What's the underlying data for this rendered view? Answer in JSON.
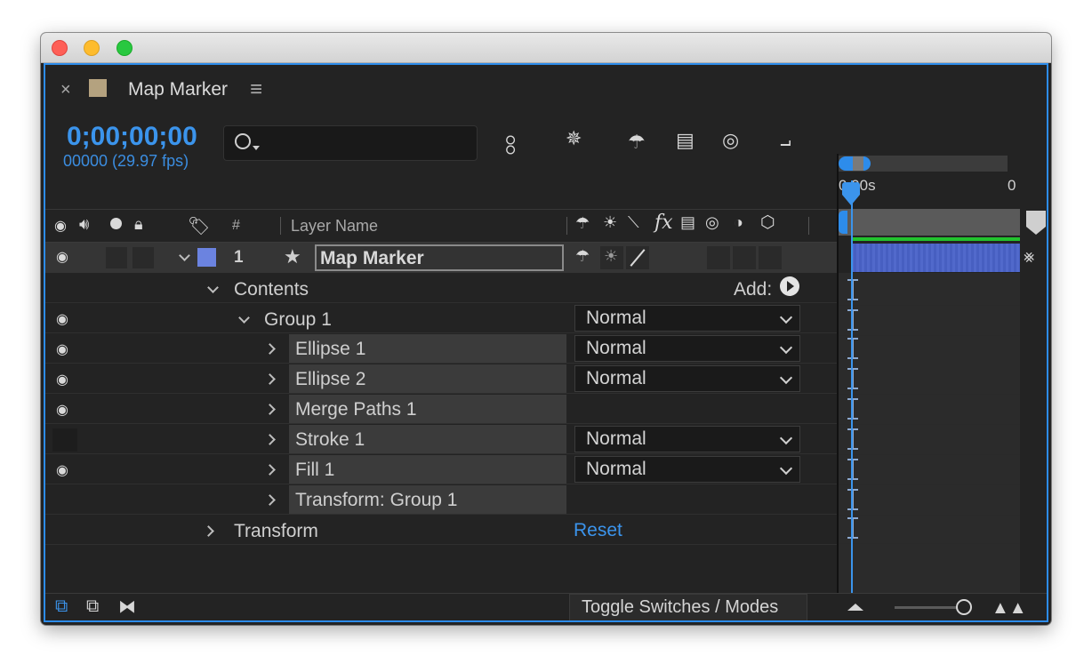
{
  "window": {
    "traffic_lights": {
      "close": "#fe5f57",
      "minimize": "#febc2e",
      "zoom": "#28c840"
    }
  },
  "panel": {
    "close_glyph": "×",
    "swatch_color": "#b4a27f",
    "title": "Map Marker",
    "menu_glyph": "≡",
    "accent": "#2d8ceb"
  },
  "time": {
    "timecode": "0;00;00;00",
    "frames": "00000 (29.97 fps)"
  },
  "search": {
    "placeholder": "",
    "value": ""
  },
  "toolbar": {
    "icons": [
      "composition-flowchart-icon",
      "draft-3d-icon",
      "shy-layers-icon",
      "frame-blending-icon",
      "motion-blur-icon",
      "graph-editor-icon"
    ]
  },
  "columns": {
    "number": "#",
    "layer_name": "Layer Name",
    "switches_fx": "fx"
  },
  "layer": {
    "index": "1",
    "name": "Map Marker",
    "label_color": "#6b83e0"
  },
  "tree": {
    "contents_label": "Contents",
    "add_label": "Add:",
    "group_label": "Group 1",
    "items": [
      {
        "name": "Ellipse 1",
        "mode": "Normal",
        "visible": true
      },
      {
        "name": "Ellipse 2",
        "mode": "Normal",
        "visible": true
      },
      {
        "name": "Merge Paths 1",
        "mode": "",
        "visible": true
      },
      {
        "name": "Stroke 1",
        "mode": "Normal",
        "visible": false
      },
      {
        "name": "Fill 1",
        "mode": "Normal",
        "visible": true
      },
      {
        "name": "Transform: Group 1",
        "mode": "",
        "visible": false
      }
    ],
    "group_mode": "Normal",
    "transform_label": "Transform",
    "reset_label": "Reset"
  },
  "timeline": {
    "ruler_start": "0:00s",
    "ruler_end": "0",
    "bar_color": "#4a63c9",
    "work_area_color": "#22c22e"
  },
  "bottom": {
    "toggle_label": "Toggle Switches / Modes"
  }
}
